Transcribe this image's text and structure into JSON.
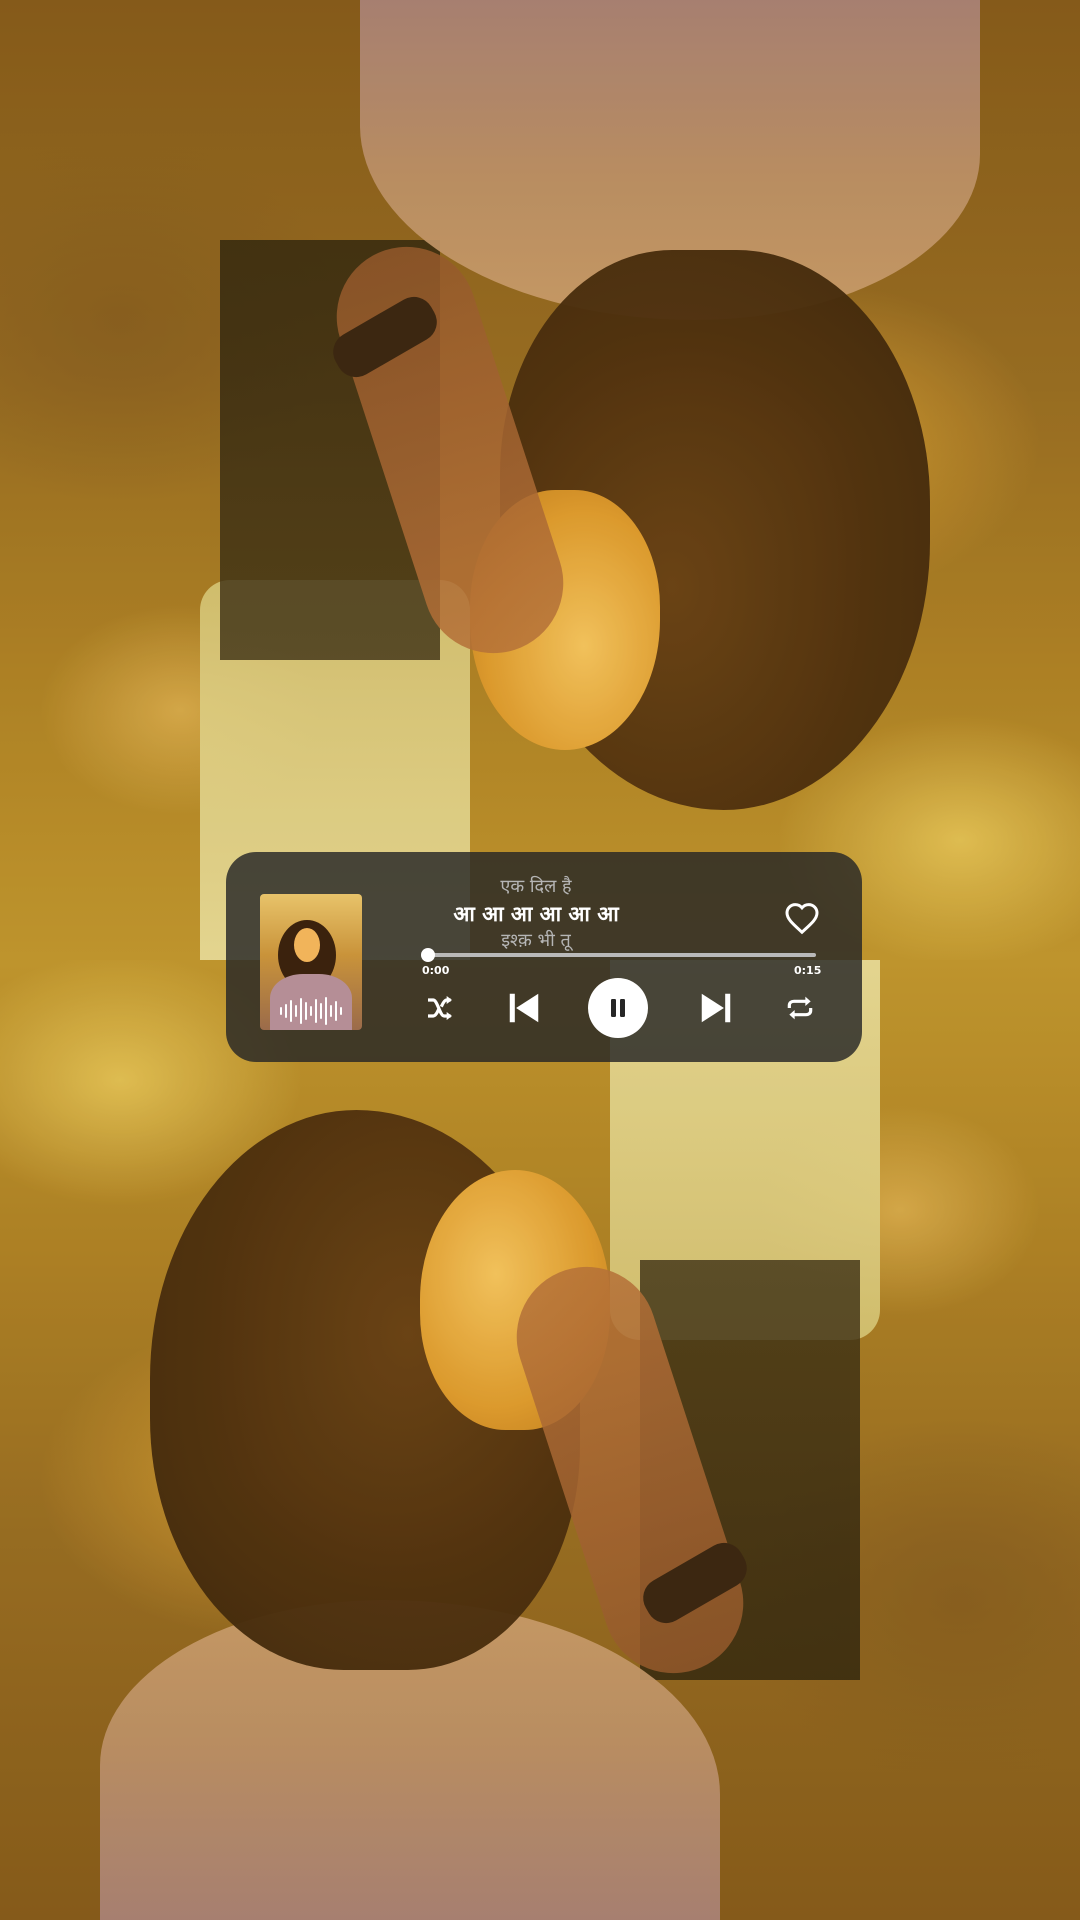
{
  "player": {
    "title_top": "एक दिल है",
    "title_main": "आ आ आ आ आ आ",
    "title_sub": "इश्क़ भी तू",
    "time_elapsed": "0:00",
    "time_total": "0:15",
    "progress_fraction": 0.0,
    "controls": {
      "shuffle_icon": "shuffle-icon",
      "previous_icon": "skip-previous-icon",
      "play_pause_icon": "pause-icon",
      "next_icon": "skip-next-icon",
      "repeat_icon": "repeat-icon",
      "like_icon": "heart-outline-icon"
    },
    "colors": {
      "card": "#262626",
      "primary_text": "#ffffff",
      "secondary_text": "#b5b5b5",
      "track": "#b9b9b9"
    }
  }
}
